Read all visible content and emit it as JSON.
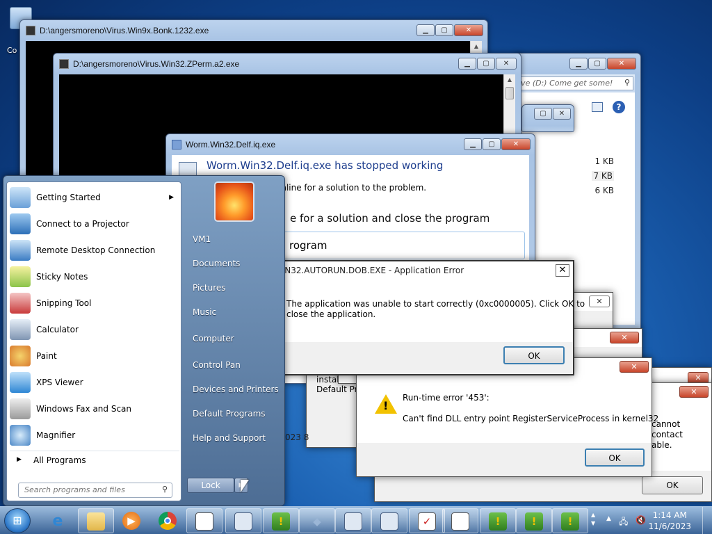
{
  "desktop": {
    "icon_label": "Co"
  },
  "windows": {
    "bonk": {
      "title": "D:\\angersmoreno\\Virus.Win9x.Bonk.1232.exe"
    },
    "zperm": {
      "title": "D:\\angersmoreno\\Virus.Win32.ZPerm.a2.exe"
    },
    "explorer": {
      "search_placeholder": "ive (D:) Come get some!",
      "sizes": [
        "1 KB",
        "7 KB",
        "6 KB"
      ]
    },
    "delf": {
      "title": "Worm.Win32.Delf.iq.exe",
      "heading": "Worm.Win32.Delf.iq.exe has stopped working",
      "text": "online for a solution to the problem.",
      "option1": "e for a solution and close the program",
      "option2": "rogram"
    }
  },
  "dialogs": {
    "autorun": {
      "title": "WORM.WIN32.AUTORUN.DOB.EXE - Application Error",
      "message_line1": "The application was unable to start correctly (0xc0000005). Click OK to",
      "message_line2": "close the application.",
      "ok_label": "OK"
    },
    "hidden1": {
      "line1": "install an e",
      "line2": "Default Pro",
      "date_fragment": "023 8"
    },
    "runtime": {
      "error_title": "Run-time error '453':",
      "message": "Can't find DLL entry point RegisterServiceProcess in kernel32",
      "ok_label": "OK"
    },
    "back_right": {
      "lines": [
        "cannot",
        "contact",
        "able."
      ],
      "ok_label": "OK"
    }
  },
  "start_menu": {
    "items": [
      {
        "label": "Getting Started",
        "icon": "getting-started-icon",
        "has_arrow": true
      },
      {
        "label": "Connect to a Projector",
        "icon": "projector-icon"
      },
      {
        "label": "Remote Desktop Connection",
        "icon": "remote-desktop-icon"
      },
      {
        "label": "Sticky Notes",
        "icon": "sticky-notes-icon"
      },
      {
        "label": "Snipping Tool",
        "icon": "snipping-tool-icon"
      },
      {
        "label": "Calculator",
        "icon": "calculator-icon"
      },
      {
        "label": "Paint",
        "icon": "paint-icon"
      },
      {
        "label": "XPS Viewer",
        "icon": "xps-viewer-icon"
      },
      {
        "label": "Windows Fax and Scan",
        "icon": "fax-scan-icon"
      },
      {
        "label": "Magnifier",
        "icon": "magnifier-icon"
      }
    ],
    "all_programs": "All Programs",
    "search_placeholder": "Search programs and files",
    "right": [
      "VM1",
      "Documents",
      "Pictures",
      "Music",
      "Computer",
      "Control Pan",
      "Devices and Printers",
      "Default Programs",
      "Help and Support"
    ],
    "lock_label": "Lock"
  },
  "taskbar": {
    "clock_time": "1:14 AM",
    "clock_date": "11/6/2023"
  }
}
